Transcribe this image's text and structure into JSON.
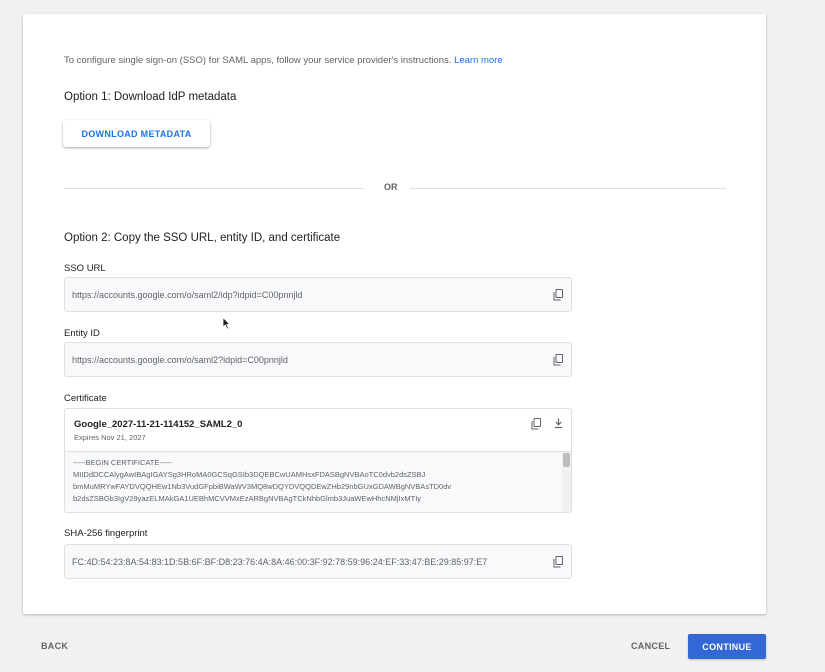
{
  "intro": {
    "text": "To configure single sign-on (SSO) for SAML apps, follow your service provider's instructions.",
    "link": "Learn more"
  },
  "option1": {
    "heading": "Option 1: Download IdP metadata",
    "download_label": "DOWNLOAD METADATA"
  },
  "divider": {
    "label": "OR"
  },
  "option2": {
    "heading": "Option 2: Copy the SSO URL, entity ID, and certificate",
    "sso_url": {
      "label": "SSO URL",
      "value": "https://accounts.google.com/o/saml2/idp?idpid=C00pnnjld"
    },
    "entity_id": {
      "label": "Entity ID",
      "value": "https://accounts.google.com/o/saml2?idpid=C00pnnjld"
    },
    "certificate": {
      "label": "Certificate",
      "name": "Google_2027-11-21-114152_SAML2_0",
      "expires": "Expires Nov 21, 2027",
      "lines": [
        "-----BEGIN CERTIFICATE-----",
        "MIIDdDCCAlygAwIBAgIGAYSg3HRoMA0GCSqGSIb3DQEBCwUAMHsxFDASBgNVBAoTC0dvb2dsZSBJ",
        "bmMuMRYwFAYDVQQHEw1Nb3VudGFpbiBWaWV3MQ8wDQYDVQQDEwZHb29nbGUxGDAWBgNVBAsTD0dv",
        "b2dsZSBGb3IgV29yazELMAkGA1UEBhMCVVMxEzARBgNVBAgTCkNhbGlmb3JuaWEwHhcNMjIxMTIy"
      ]
    },
    "fingerprint": {
      "label": "SHA-256 fingerprint",
      "value": "FC:4D:54:23:8A:54:83:1D:5B:6F:BF:D8:23:76:4A:8A:46:00:3F:92:78:59:96:24:EF:33:47:BE:29:85:97:E7"
    }
  },
  "footer": {
    "back": "BACK",
    "cancel": "CANCEL",
    "continue": "CONTINUE"
  },
  "icons": {
    "copy": "copy-icon",
    "download": "download-icon",
    "cursor": "mouse-cursor-icon"
  },
  "colors": {
    "accent": "#1a73e8",
    "primary_button": "#3367d6"
  }
}
